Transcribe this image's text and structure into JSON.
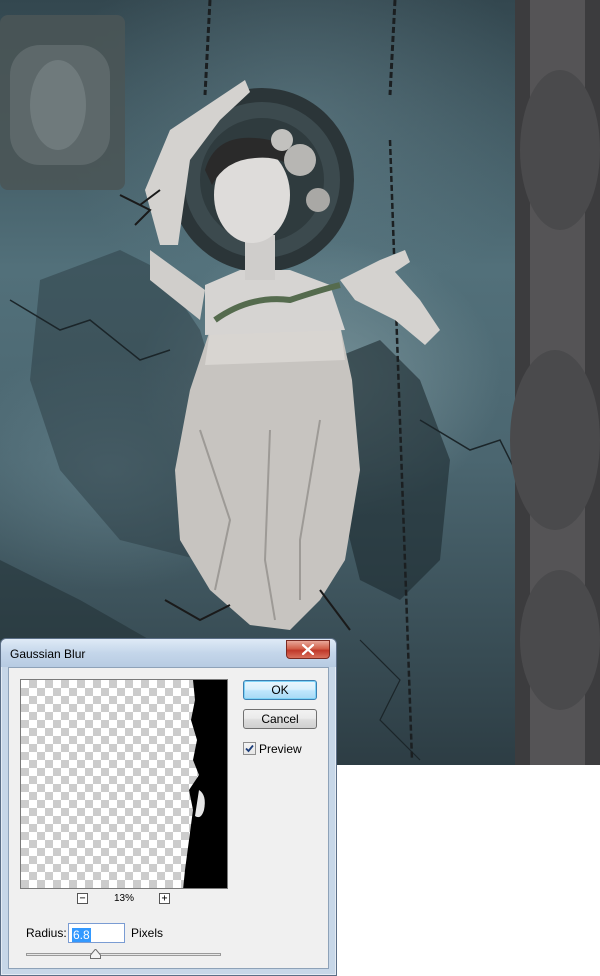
{
  "dialog": {
    "title": "Gaussian Blur",
    "ok_label": "OK",
    "cancel_label": "Cancel",
    "preview": {
      "label": "Preview",
      "checked": true
    },
    "zoom": {
      "level": "13%",
      "zoom_out_icon": "minus-icon",
      "zoom_in_icon": "plus-icon"
    },
    "radius": {
      "label": "Radius:",
      "value": "6.8",
      "units": "Pixels"
    },
    "slider": {
      "value": 6.8
    },
    "close_icon": "close-icon"
  },
  "colors": {
    "ok_border": "#3c7fb1",
    "close_button": "#c0382a",
    "selection": "#3399ff",
    "dialog_frame": "#c7d7e8"
  }
}
